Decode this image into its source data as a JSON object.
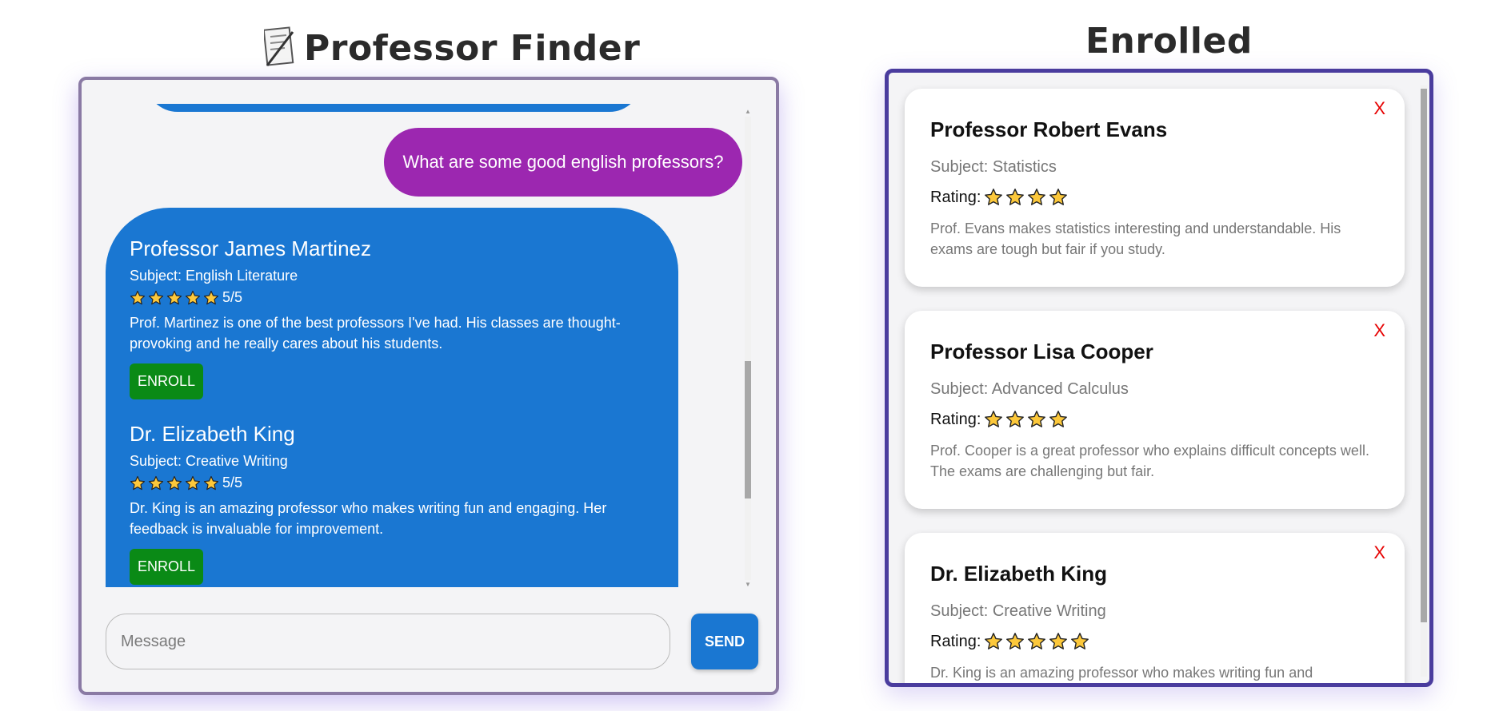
{
  "chat": {
    "title": "Professor Finder",
    "title_icon": "memo-icon",
    "user_message": "What are some good english professors?",
    "professors": [
      {
        "name": "Professor James Martinez",
        "subject": "Subject: English Literature",
        "stars": 5,
        "rating_text": "5/5",
        "review": "Prof. Martinez is one of the best professors I've had. His classes are thought-provoking and he really cares about his students.",
        "button": "ENROLL"
      },
      {
        "name": "Dr. Elizabeth King",
        "subject": "Subject: Creative Writing",
        "stars": 5,
        "rating_text": "5/5",
        "review": "Dr. King is an amazing professor who makes writing fun and engaging. Her feedback is invaluable for improvement.",
        "button": "ENROLL"
      }
    ],
    "input_placeholder": "Message",
    "send_label": "SEND",
    "colors": {
      "bot_bubble": "#1a77d2",
      "user_bubble": "#9c27b0",
      "enroll_button": "#0a8a16"
    }
  },
  "enrolled": {
    "title": "Enrolled",
    "remove_label": "X",
    "rating_label": "Rating:",
    "cards": [
      {
        "name": "Professor Robert Evans",
        "subject": "Subject: Statistics",
        "stars": 4,
        "review": "Prof. Evans makes statistics interesting and understandable. His exams are tough but fair if you study."
      },
      {
        "name": "Professor Lisa Cooper",
        "subject": "Subject: Advanced Calculus",
        "stars": 4,
        "review": "Prof. Cooper is a great professor who explains difficult concepts well. The exams are challenging but fair."
      },
      {
        "name": "Dr. Elizabeth King",
        "subject": "Subject: Creative Writing",
        "stars": 5,
        "review": "Dr. King is an amazing professor who makes writing fun and engaging. Her feedback is invaluable for improvement."
      }
    ]
  }
}
